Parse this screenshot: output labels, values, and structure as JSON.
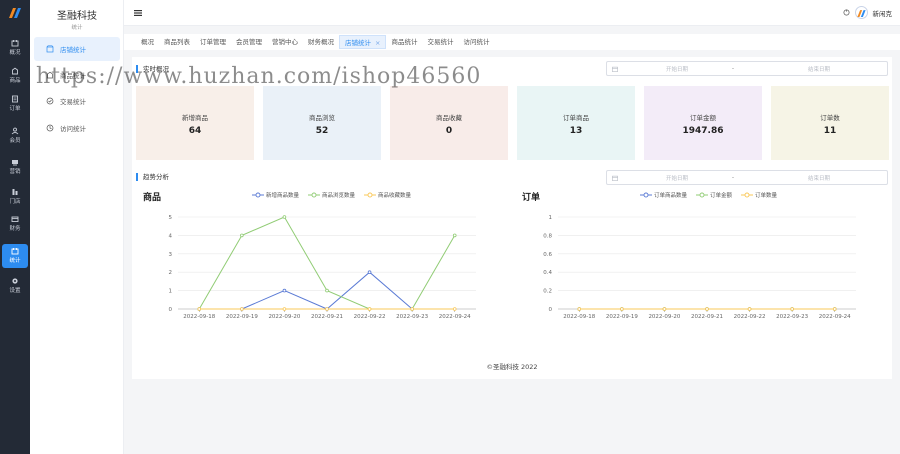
{
  "brand": {
    "name": "圣融科技",
    "subtitle": "统计"
  },
  "rail": [
    {
      "label": "概况",
      "icon": "overview-icon"
    },
    {
      "label": "商品",
      "icon": "goods-icon"
    },
    {
      "label": "订单",
      "icon": "order-icon"
    },
    {
      "label": "会员",
      "icon": "member-icon"
    },
    {
      "label": "营销",
      "icon": "marketing-icon"
    },
    {
      "label": "门店",
      "icon": "store-icon"
    },
    {
      "label": "财务",
      "icon": "finance-icon"
    },
    {
      "label": "统计",
      "icon": "stats-icon",
      "active": true
    },
    {
      "label": "设置",
      "icon": "settings-icon"
    }
  ],
  "sidebar": {
    "items": [
      {
        "label": "店铺统计",
        "active": true
      },
      {
        "label": "商品统计"
      },
      {
        "label": "交易统计"
      },
      {
        "label": "访问统计"
      }
    ]
  },
  "header": {
    "user": "新闲克"
  },
  "tabs": [
    {
      "label": "概况"
    },
    {
      "label": "商品列表"
    },
    {
      "label": "订单管理"
    },
    {
      "label": "会员管理"
    },
    {
      "label": "营销中心"
    },
    {
      "label": "财务概况"
    },
    {
      "label": "店铺统计",
      "active": true,
      "close": "×"
    },
    {
      "label": "商品统计"
    },
    {
      "label": "交易统计"
    },
    {
      "label": "访问统计"
    }
  ],
  "realtime": {
    "title": "实时概况",
    "date_start": "开始日期",
    "date_sep": "-",
    "date_end": "结束日期",
    "cards": [
      {
        "label": "新增商品",
        "value": "64",
        "color": "#f8efe9"
      },
      {
        "label": "商品浏览",
        "value": "52",
        "color": "#eaf1f8"
      },
      {
        "label": "商品收藏",
        "value": "0",
        "color": "#f8ece9"
      },
      {
        "label": "订单商品",
        "value": "13",
        "color": "#e9f5f5"
      },
      {
        "label": "订单金额",
        "value": "1947.86",
        "color": "#f3ecf8"
      },
      {
        "label": "订单数",
        "value": "11",
        "color": "#f6f4e6"
      }
    ]
  },
  "trend": {
    "title": "趋势分析",
    "date_start": "开始日期",
    "date_sep": "-",
    "date_end": "结束日期"
  },
  "chart_data": [
    {
      "type": "line",
      "title": "商品",
      "x": [
        "2022-09-18",
        "2022-09-19",
        "2022-09-20",
        "2022-09-21",
        "2022-09-22",
        "2022-09-23",
        "2022-09-24"
      ],
      "ylim": [
        0,
        5
      ],
      "yticks": [
        0,
        1,
        2,
        3,
        4,
        5
      ],
      "grid": true,
      "legend": "top",
      "series": [
        {
          "name": "新增商品数量",
          "color": "#5b7bd5",
          "values": [
            0,
            0,
            1,
            0,
            2,
            0,
            null
          ]
        },
        {
          "name": "商品浏览数量",
          "color": "#91cc75",
          "values": [
            0,
            4,
            5,
            1,
            0,
            0,
            4
          ]
        },
        {
          "name": "商品收藏数量",
          "color": "#fac858",
          "values": [
            0,
            0,
            0,
            0,
            0,
            0,
            0
          ]
        }
      ]
    },
    {
      "type": "line",
      "title": "订单",
      "x": [
        "2022-09-18",
        "2022-09-19",
        "2022-09-20",
        "2022-09-21",
        "2022-09-22",
        "2022-09-23",
        "2022-09-24"
      ],
      "ylim": [
        0,
        1
      ],
      "yticks": [
        0,
        0.2,
        0.4,
        0.6,
        0.8,
        1
      ],
      "grid": true,
      "legend": "top",
      "series": [
        {
          "name": "订单商品数量",
          "color": "#5b7bd5",
          "values": [
            0,
            0,
            0,
            0,
            0,
            0,
            0
          ]
        },
        {
          "name": "订单金额",
          "color": "#91cc75",
          "values": [
            0,
            0,
            0,
            0,
            0,
            0,
            0
          ]
        },
        {
          "name": "订单数量",
          "color": "#fac858",
          "values": [
            0,
            0,
            0,
            0,
            0,
            0,
            0
          ]
        }
      ]
    }
  ],
  "footer": {
    "text": "©圣融科技 2022"
  },
  "watermark": {
    "text": "https://www.huzhan.com/ishop46560"
  }
}
